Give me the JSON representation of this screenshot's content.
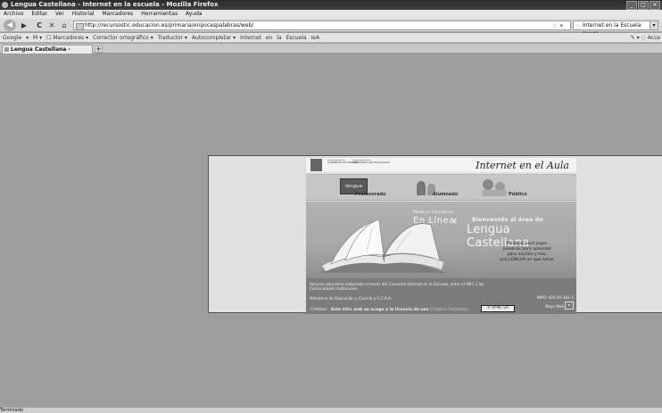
{
  "window": {
    "title": "Lengua Castellana - Internet en la escuela - Mozilla Firefox",
    "controls": [
      "_",
      "□",
      "×"
    ]
  },
  "menubar": [
    "Archivo",
    "Editar",
    "Ver",
    "Historial",
    "Marcadores",
    "Herramientas",
    "Ayuda"
  ],
  "navbar": {
    "back": "◀",
    "forward": "▶",
    "reload": "C",
    "stop": "✕",
    "home": "⌂",
    "url": "http://recursostic.educacion.es/primaria/enpocaspalabras/web/",
    "search_value": "Internet en la Escuela (IesA).",
    "star": "☆ ▾"
  },
  "google_toolbar": {
    "items": [
      "Google",
      "▾",
      "M ▾",
      "☐ Marcadores ▾",
      "Corrector ortográfico ▾",
      "Traductor ▾",
      "Autocompletar ▾",
      "Internet",
      "en",
      "la",
      "Escuela",
      "IeA"
    ],
    "right": "✎ ▾ ◌ Acce"
  },
  "tabs": [
    {
      "label": "Lengua Castellana - Internet ..."
    }
  ],
  "newtab": "+",
  "status": "Terminado",
  "site": {
    "header_title": "Internet en el Aula",
    "gov_left": "GOBIERNO DE ESPAÑA",
    "gov_right": "MINISTERIO DE EDUCACIÓN",
    "nav": {
      "lengua_tile": "lengua",
      "profesorado": "Profesorado",
      "alumnado": "Alumnado",
      "publico": "Público"
    },
    "banner": {
      "pre": "Palabras Educativas",
      "en_linea": "En Línea",
      "bienvenido": "Bienvenido al área de",
      "lengua": "Lengua Castellana",
      "tagline": [
        "Palabras para jugar,",
        "palabras para aprender",
        "para escribir y leer,",
        "una LENGUA en que soñar."
      ]
    },
    "footer": {
      "recurso": "Recurso educativo elaborado a través del Convenio Internet en la Escuela, entre el MEC y las Comunidades Autónomas",
      "ministerio": "Ministerio de Educación y Ciencia y C.C.A.A.",
      "nipo": "NIPO: 820-05-181-3",
      "creditos": "Créditos",
      "licencia": "Este sitio web se acoge a la licencia de uso",
      "licencia_cc": "Creative Commons",
      "cc_badge": "© BY-NC-SA",
      "mapa": "Mapa Web"
    }
  }
}
